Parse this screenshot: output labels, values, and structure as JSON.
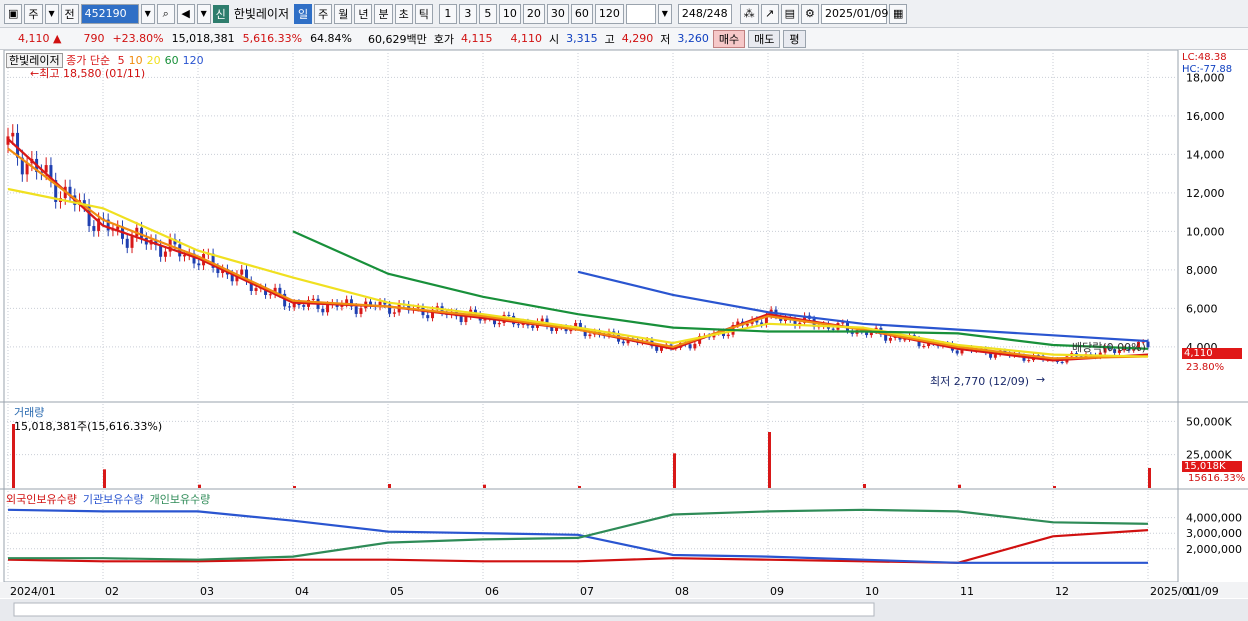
{
  "toolbar": {
    "market": "주",
    "prev": "전",
    "code": "452190",
    "badge": "신",
    "name": "한빛레이저",
    "periods": [
      "일",
      "주",
      "월",
      "년",
      "분",
      "초",
      "틱"
    ],
    "active_period": "일",
    "intervals": [
      "1",
      "3",
      "5",
      "10",
      "20",
      "30",
      "60",
      "120"
    ],
    "count": "248",
    "count_total": "/248",
    "date": "2025/01/09"
  },
  "quote": {
    "price": "4,110",
    "arrow": "▲",
    "change": "790",
    "change_pct": "+23.80%",
    "volume": "15,018,381",
    "volume_pct": "5,616.33%",
    "ratio": "64.84%",
    "amount": "60,629백만",
    "bid_label": "호가",
    "bid": "4,115",
    "ask": "4,110",
    "open_label": "시",
    "open": "3,315",
    "high_label": "고",
    "high": "4,290",
    "low_label": "저",
    "low": "3,260",
    "buy": "매수",
    "sell": "매도",
    "eval": "평"
  },
  "price_panel": {
    "legend_name": "한빛레이저",
    "legend_ma": "종가 단순",
    "ma_periods": [
      "5",
      "10",
      "20",
      "60",
      "120"
    ],
    "ma_colors": [
      "#d81818",
      "#f08c10",
      "#f0e020",
      "#18903a",
      "#2a55d0"
    ],
    "lc": "LC:48.38",
    "hc": "HC:-77.88",
    "high_note": "←최고 18,580 (01/11)",
    "low_note": "최저 2,770 (12/09)",
    "low_arrow": "→",
    "dividend_note": "배당락(0.00%)",
    "last_price": "4,110",
    "last_pct": "23.80%"
  },
  "volume_panel": {
    "title": "거래량",
    "subtitle": "15,018,381주(15,616.33%)",
    "last": "15,018K",
    "last_pct": "15616.33%"
  },
  "holding_panel": {
    "series_labels": [
      "외국인보유수량",
      "기관보유수량",
      "개인보유수량"
    ],
    "colors": [
      "#d01010",
      "#2a55d0",
      "#2e8b57"
    ]
  },
  "xaxis": {
    "labels": [
      "2024/01",
      "02",
      "03",
      "04",
      "05",
      "06",
      "07",
      "08",
      "09",
      "10",
      "11",
      "12",
      "2025/01"
    ],
    "right_label": "01/09"
  },
  "chart_data": [
    {
      "type": "candlestick",
      "title": "",
      "x": [
        "2024/01",
        "02",
        "03",
        "04",
        "05",
        "06",
        "07",
        "08",
        "09",
        "10",
        "11",
        "12",
        "2025/01"
      ],
      "ylim": [
        1500,
        18800
      ],
      "yticks": [
        4000,
        6000,
        8000,
        10000,
        12000,
        14000,
        16000,
        18000
      ],
      "ytick_labels": [
        "4,000",
        "6,000",
        "8,000",
        "10,000",
        "12,000",
        "14,000",
        "16,000",
        "18,000"
      ],
      "close_by_month": [
        14500,
        10200,
        8600,
        6200,
        6100,
        5500,
        4900,
        3900,
        5600,
        4800,
        3900,
        3300,
        4110
      ],
      "ma_series": [
        {
          "name": "5",
          "values": [
            14800,
            10300,
            8600,
            6300,
            6100,
            5500,
            4900,
            3900,
            5700,
            4900,
            3900,
            3300,
            3600
          ]
        },
        {
          "name": "10",
          "values": [
            14300,
            10600,
            8700,
            6400,
            6100,
            5600,
            4900,
            4000,
            5600,
            4900,
            4000,
            3400,
            3500
          ]
        },
        {
          "name": "20",
          "values": [
            12200,
            11200,
            9000,
            7600,
            6300,
            5700,
            5000,
            4200,
            5200,
            5000,
            4100,
            3600,
            3500
          ]
        },
        {
          "name": "60",
          "values": [
            null,
            null,
            null,
            10000,
            7800,
            6600,
            5700,
            5000,
            4800,
            4800,
            4700,
            4100,
            3900
          ]
        },
        {
          "name": "120",
          "values": [
            null,
            null,
            null,
            null,
            null,
            null,
            7900,
            6700,
            5800,
            5200,
            4900,
            4600,
            4300
          ]
        }
      ],
      "high": {
        "value": 18580,
        "date": "01/11"
      },
      "low": {
        "value": 2770,
        "date": "12/09"
      }
    },
    {
      "type": "bar",
      "title": "거래량",
      "ylim": [
        0,
        60000000
      ],
      "yticks": [
        25000000,
        50000000
      ],
      "ytick_labels": [
        "25,000K",
        "50,000K"
      ],
      "x": [
        "2024/01",
        "02",
        "03",
        "04",
        "05",
        "06",
        "07",
        "08",
        "09",
        "10",
        "11",
        "12",
        "2025/01"
      ],
      "values": [
        48000000,
        14000000,
        2500000,
        1500000,
        3000000,
        2500000,
        1500000,
        26000000,
        42000000,
        3000000,
        2500000,
        1500000,
        15018381
      ]
    },
    {
      "type": "line",
      "title": "",
      "ylim": [
        0,
        5000000
      ],
      "yticks": [
        2000000,
        3000000,
        4000000
      ],
      "ytick_labels": [
        "2,000,000",
        "3,000,000",
        "4,000,000"
      ],
      "x": [
        "2024/01",
        "02",
        "03",
        "04",
        "05",
        "06",
        "07",
        "08",
        "09",
        "10",
        "11",
        "12",
        "2025/01"
      ],
      "series": [
        {
          "name": "외국인보유수량",
          "values": [
            1300000,
            1200000,
            1200000,
            1300000,
            1300000,
            1200000,
            1200000,
            1400000,
            1300000,
            1200000,
            1100000,
            2800000,
            3200000
          ]
        },
        {
          "name": "기관보유수량",
          "values": [
            4500000,
            4400000,
            4400000,
            3800000,
            3100000,
            3000000,
            2900000,
            1600000,
            1500000,
            1300000,
            1100000,
            1100000,
            1100000
          ]
        },
        {
          "name": "개인보유수량",
          "values": [
            1400000,
            1400000,
            1300000,
            1500000,
            2400000,
            2600000,
            2700000,
            4200000,
            4400000,
            4500000,
            4400000,
            3700000,
            3600000
          ]
        }
      ]
    }
  ]
}
